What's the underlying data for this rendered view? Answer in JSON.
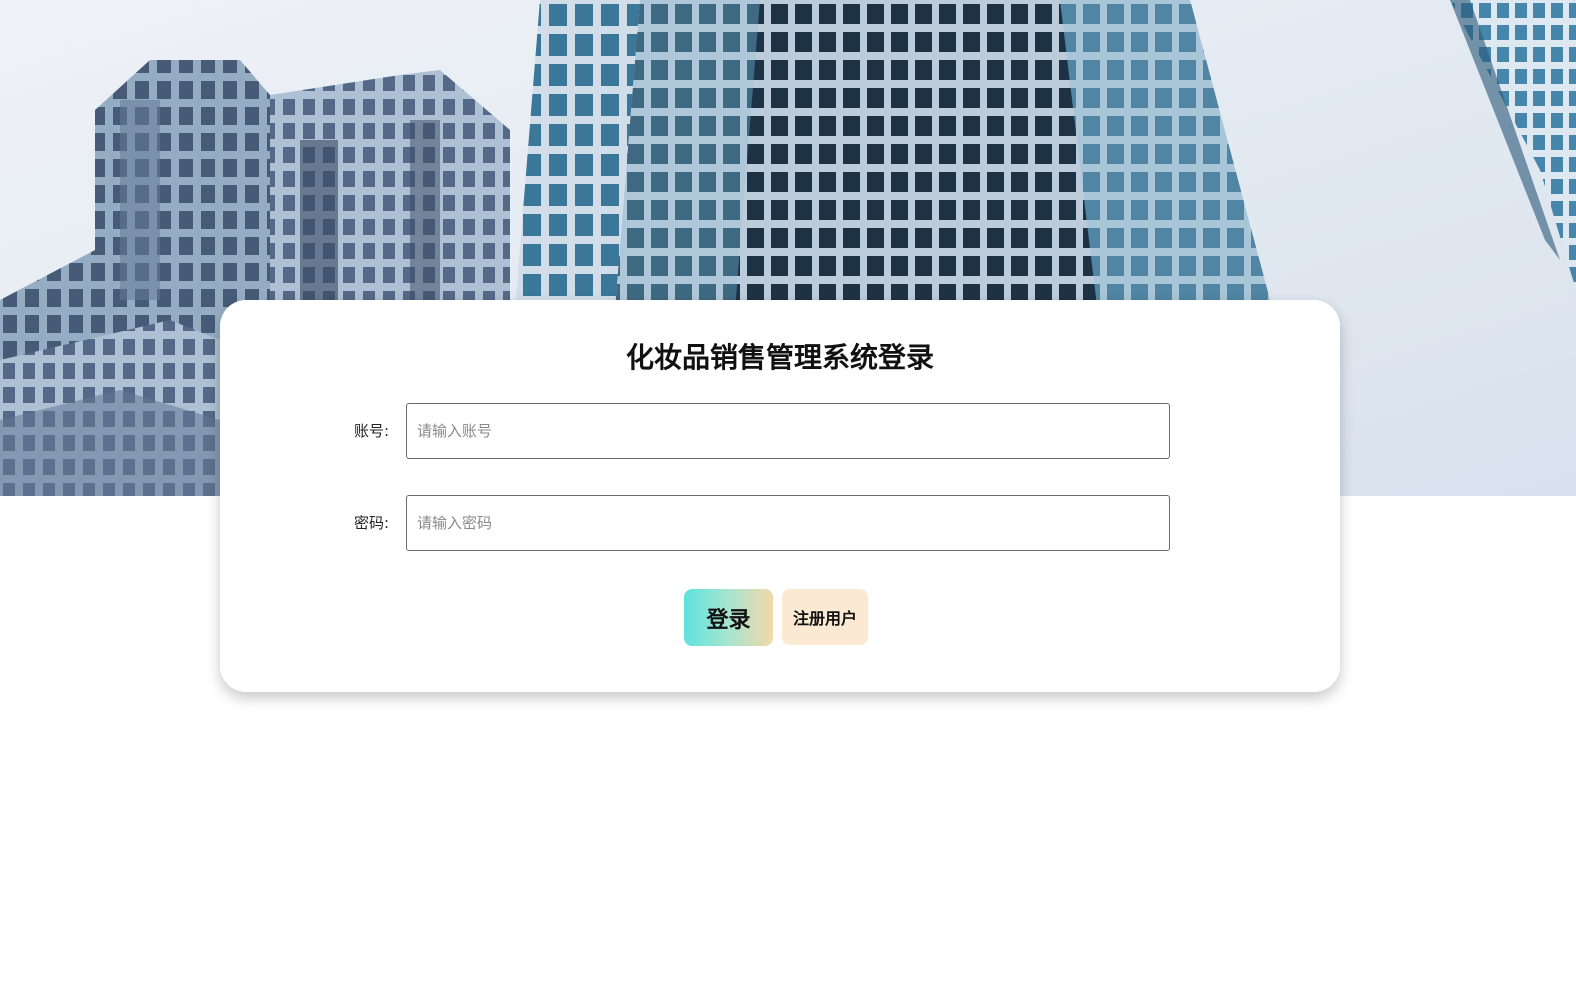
{
  "login": {
    "title": "化妆品销售管理系统登录",
    "account_label": "账号:",
    "account_placeholder": "请输入账号",
    "account_value": "",
    "password_label": "密码:",
    "password_placeholder": "请输入密码",
    "password_value": "",
    "login_button": "登录",
    "register_button": "注册用户"
  },
  "colors": {
    "login_gradient": [
      "#5ee3df",
      "#f2d9a9"
    ],
    "register_bg": "#fbe9d4",
    "card_bg": "#ffffff"
  },
  "background": {
    "image": "office-buildings-photo"
  }
}
